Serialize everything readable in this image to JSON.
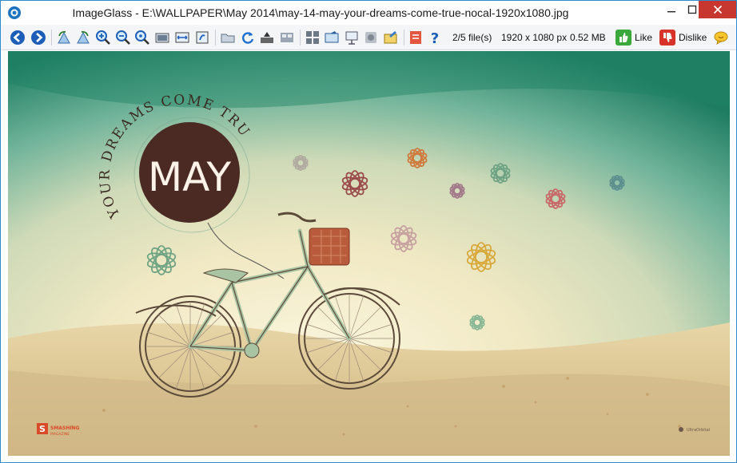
{
  "window": {
    "title": "ImageGlass - E:\\WALLPAPER\\May 2014\\may-14-may-your-dreams-come-true-nocal-1920x1080.jpg"
  },
  "toolbar": {
    "file_count": "2/5 file(s)",
    "dimensions": "1920 x 1080 px",
    "file_size": "0.52 MB",
    "like_label": "Like",
    "dislike_label": "Dislike",
    "icons": [
      "back-icon",
      "forward-icon",
      "rotate-left-icon",
      "rotate-right-icon",
      "zoom-in-icon",
      "zoom-out-icon",
      "actual-size-icon",
      "zoom-lock-icon",
      "scale-to-width-icon",
      "scale-to-height-icon",
      "open-file-icon",
      "refresh-icon",
      "goto-icon",
      "thumbnail-icon",
      "checkerboard-icon",
      "fullscreen-icon",
      "slideshow-icon",
      "convert-icon",
      "set-wallpaper-icon",
      "settings-icon",
      "help-icon",
      "like-icon",
      "dislike-icon",
      "feedback-icon"
    ]
  },
  "wallpaper": {
    "arc_text": "YOUR DREAMS COME TRUE",
    "badge_text": "MAY",
    "brand_text": "SMASHING",
    "brand_sub": "MAGAZINE",
    "credit_text": "UltraOrbital"
  }
}
